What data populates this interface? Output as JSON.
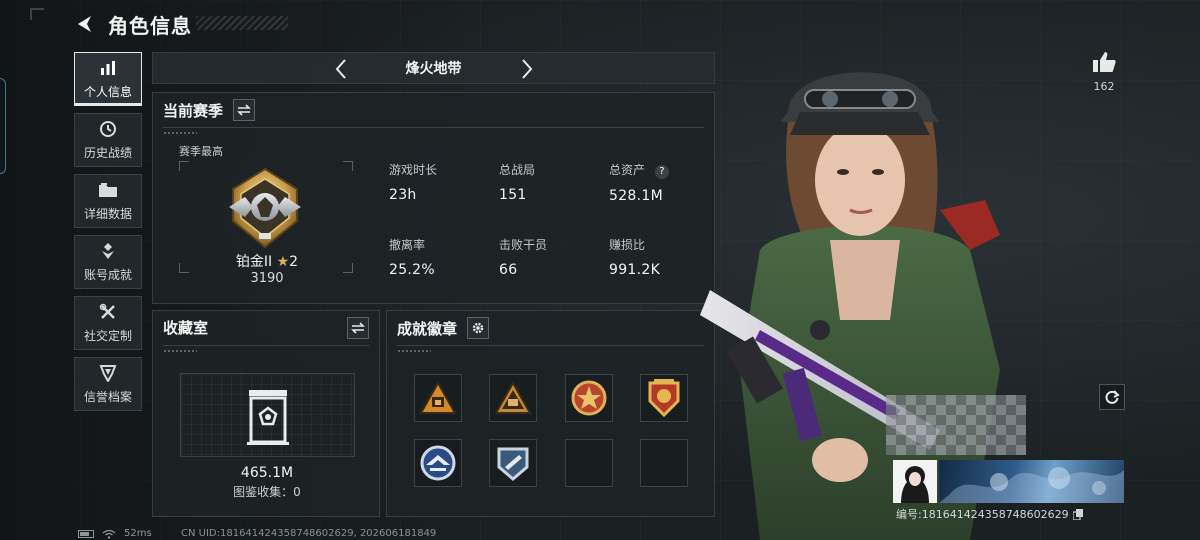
{
  "header": {
    "title": "角色信息"
  },
  "sidenav": {
    "items": [
      {
        "label": "个人信息",
        "icon": "bar-chart-icon",
        "active": true
      },
      {
        "label": "历史战绩",
        "icon": "history-icon",
        "active": false
      },
      {
        "label": "详细数据",
        "icon": "folder-icon",
        "active": false
      },
      {
        "label": "账号成就",
        "icon": "achievement-icon",
        "active": false
      },
      {
        "label": "社交定制",
        "icon": "tools-icon",
        "active": false
      },
      {
        "label": "信誉档案",
        "icon": "credit-shield-icon",
        "active": false
      }
    ]
  },
  "mode": {
    "name": "烽火地带"
  },
  "season": {
    "title": "当前赛季",
    "best_label": "赛季最高",
    "rank_name": "铂金II",
    "rank_stars": "2",
    "rank_score": "3190",
    "stats": [
      {
        "label": "游戏时长",
        "value": "23h"
      },
      {
        "label": "总战局",
        "value": "151"
      },
      {
        "label": "总资产",
        "value": "528.1M"
      },
      {
        "label": "撤离率",
        "value": "25.2%"
      },
      {
        "label": "击败干员",
        "value": "66"
      },
      {
        "label": "赚损比",
        "value": "991.2K"
      }
    ]
  },
  "collection": {
    "title": "收藏室",
    "value": "465.1M",
    "progress_text": "图鉴收集：0"
  },
  "badges": {
    "title": "成就徽章",
    "slots": [
      {
        "icon": "triangle-badge-icon",
        "empty": false
      },
      {
        "icon": "triangle-badge-icon",
        "empty": false
      },
      {
        "icon": "star-medal-icon",
        "empty": false
      },
      {
        "icon": "shield-medal-icon",
        "empty": false
      },
      {
        "icon": "round-badge-icon",
        "empty": false
      },
      {
        "icon": "round-badge-icon",
        "empty": false
      },
      {
        "icon": "",
        "empty": true
      },
      {
        "icon": "",
        "empty": true
      }
    ]
  },
  "profile": {
    "likes": "162",
    "player_id": "编号:1816414243587486026​29"
  },
  "footer": {
    "ping": "52ms",
    "uid": "CN UID:1816414243587486026​29, 202606181849"
  },
  "colors": {
    "background": "#1b2023",
    "panel": "#1e2326",
    "accent": "#e6e9e8",
    "gold": "#d9b45a"
  }
}
